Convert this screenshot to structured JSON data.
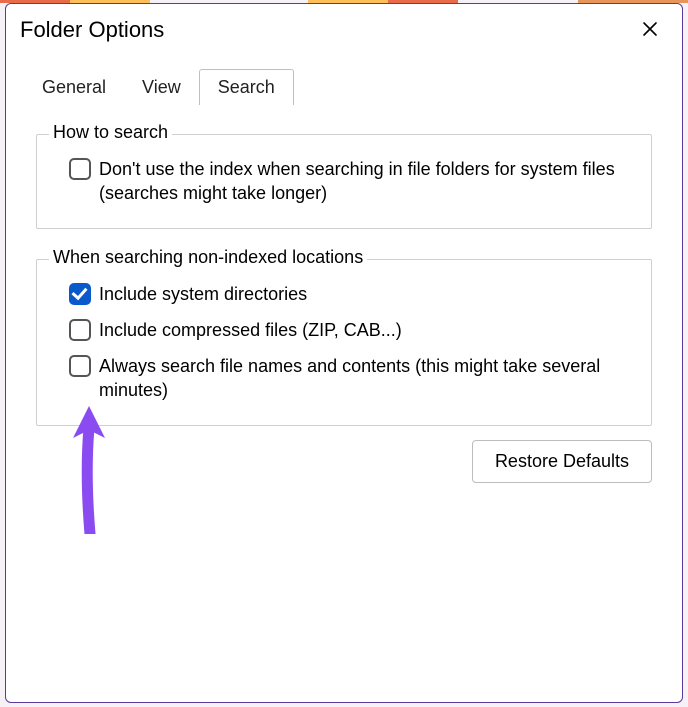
{
  "window": {
    "title": "Folder Options"
  },
  "tabs": {
    "general": "General",
    "view": "View",
    "search": "Search",
    "active": "search"
  },
  "groups": {
    "howToSearch": {
      "legend": "How to search",
      "options": {
        "dontUseIndex": {
          "checked": false,
          "label": "Don't use the index when searching in file folders for system files (searches might take longer)"
        }
      }
    },
    "nonIndexed": {
      "legend": "When searching non-indexed locations",
      "options": {
        "includeSystemDirs": {
          "checked": true,
          "label": "Include system directories"
        },
        "includeCompressed": {
          "checked": false,
          "label": "Include compressed files (ZIP, CAB...)"
        },
        "alwaysSearchContents": {
          "checked": false,
          "label": "Always search file names and contents (this might take several minutes)"
        }
      }
    }
  },
  "buttons": {
    "restoreDefaults": "Restore Defaults"
  },
  "annotation": {
    "arrowColor": "#8a4cf0"
  }
}
